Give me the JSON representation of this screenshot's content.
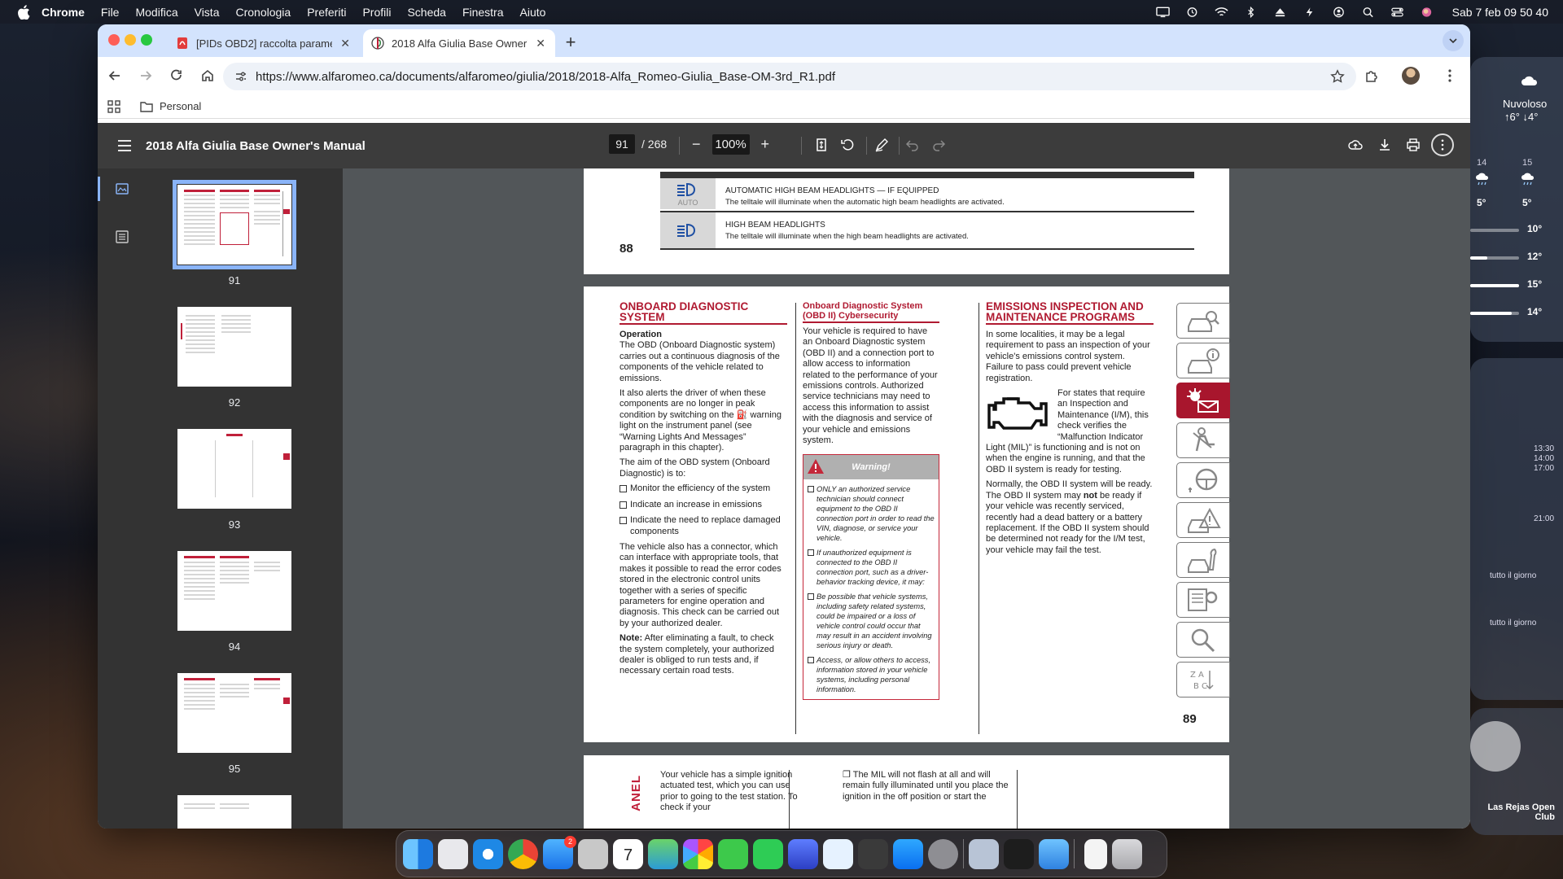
{
  "menubar": {
    "app_name": "Chrome",
    "menus": [
      "File",
      "Modifica",
      "Vista",
      "Cronologia",
      "Preferiti",
      "Profili",
      "Scheda",
      "Finestra",
      "Aiuto"
    ],
    "clock": "Sab 7 feb  09 50 40"
  },
  "browser": {
    "tabs": [
      {
        "title": "[PIDs OBD2] raccolta parame",
        "active": false
      },
      {
        "title": "2018 Alfa Giulia Base Owner's",
        "active": true
      }
    ],
    "url": "https://www.alfaromeo.ca/documents/alfaromeo/giulia/2018/2018-Alfa_Romeo-Giulia_Base-OM-3rd_R1.pdf",
    "bookmark_folder": "Personal"
  },
  "pdf": {
    "title": "2018 Alfa Giulia Base Owner's Manual",
    "current_page": "91",
    "total_pages": "/ 268",
    "zoom": "100%",
    "thumbnails": [
      "91",
      "92",
      "93",
      "94",
      "95"
    ],
    "page88": {
      "number": "88",
      "rows": [
        {
          "icon": "auto-high-beam-icon",
          "sub": "AUTO",
          "title": "AUTOMATIC HIGH BEAM HEADLIGHTS — IF EQUIPPED",
          "desc": "The telltale will illuminate when the automatic high beam headlights are activated."
        },
        {
          "icon": "high-beam-icon",
          "sub": "",
          "title": "HIGH BEAM HEADLIGHTS",
          "desc": "The telltale will illuminate when the high beam headlights are activated."
        }
      ]
    },
    "page89": {
      "number": "89",
      "col1": {
        "heading": "ONBOARD DIAGNOSTIC SYSTEM",
        "sub": "Operation",
        "p1": "The OBD (Onboard Diagnostic system) carries out a continuous diagnosis of the components of the vehicle related to emissions.",
        "p2": "It also alerts the driver of when these components are no longer in peak condition by switching on the ⛽ warning light on the instrument panel (see “Warning Lights And Messages” paragraph in this chapter).",
        "p3": "The aim of the OBD system (Onboard Diagnostic) is to:",
        "bullets": [
          "Monitor the efficiency of the system",
          "Indicate an increase in emissions",
          "Indicate the need to replace damaged components"
        ],
        "p4": "The vehicle also has a connector, which can interface with appropriate tools, that makes it possible to read the error codes stored in the electronic control units together with a series of specific parameters for engine operation and diagnosis. This check can be carried out by your authorized dealer.",
        "note_label": "Note:",
        "note": "After eliminating a fault, to check the system completely, your authorized dealer is obliged to run tests and, if necessary certain road tests."
      },
      "col2": {
        "heading": "Onboard Diagnostic System (OBD II) Cybersecurity",
        "p1": "Your vehicle is required to have an Onboard Diagnostic system (OBD II) and a connection port to allow access to information related to the performance of your emissions controls. Authorized service technicians may need to access this information to assist with the diagnosis and service of your vehicle and emissions system.",
        "warning_title": "Warning!",
        "warnings": [
          "ONLY an authorized service technician should connect equipment to the OBD II connection port in order to read the VIN, diagnose, or service your vehicle.",
          "If unauthorized equipment is connected to the OBD II connection port, such as a driver-behavior tracking device, it may:",
          "Be possible that vehicle systems, including safety related systems, could be impaired or a loss of vehicle control could occur that may result in an accident involving serious injury or death.",
          "Access, or allow others to access, information stored in your vehicle systems, including personal information."
        ]
      },
      "col3": {
        "heading": "EMISSIONS INSPECTION AND MAINTENANCE PROGRAMS",
        "p1": "In some localities, it may be a legal requirement to pass an inspection of your vehicle's emissions control system. Failure to pass could prevent vehicle registration.",
        "p2": "For states that require an Inspection and Maintenance (I/M), this check verifies the “Malfunction Indicator Light (MIL)” is functioning and is not on when the engine is running, and that the OBD II system is ready for testing.",
        "p3a": "Normally, the OBD II system will be ready. The OBD II system may ",
        "p3b": "not",
        "p3c": " be ready if your vehicle was recently serviced, recently had a dead battery or a battery replacement. If the OBD II system should be determined not ready for the I/M test, your vehicle may fail the test."
      }
    },
    "page90": {
      "side_label": "ANEL",
      "col1": "Your vehicle has a simple ignition actuated test, which you can use prior to going to the test station. To check if your",
      "col2": "❒ The MIL will not flash at all and will remain fully illuminated until you place the ignition in the off position or start the"
    }
  },
  "widgets": {
    "weather_city": "Nuvoloso",
    "weather_temps": "↑6° ↓4°",
    "days": [
      "14",
      "15"
    ],
    "day_temps": [
      "5°",
      "5°"
    ],
    "hourly": [
      "10°",
      "12°",
      "15°",
      "14°"
    ],
    "hourly_levels": [
      0.0,
      0.35,
      1.0,
      0.85
    ],
    "calendar_times": [
      "13:30",
      "14:00",
      "17:00"
    ],
    "calendar_time2": "21:00",
    "allday": [
      "tutto il giorno",
      "tutto il giorno"
    ],
    "place": "Las Rejas Open Club"
  },
  "dock": {
    "mail_badge": "2",
    "calendar_day": "7"
  }
}
